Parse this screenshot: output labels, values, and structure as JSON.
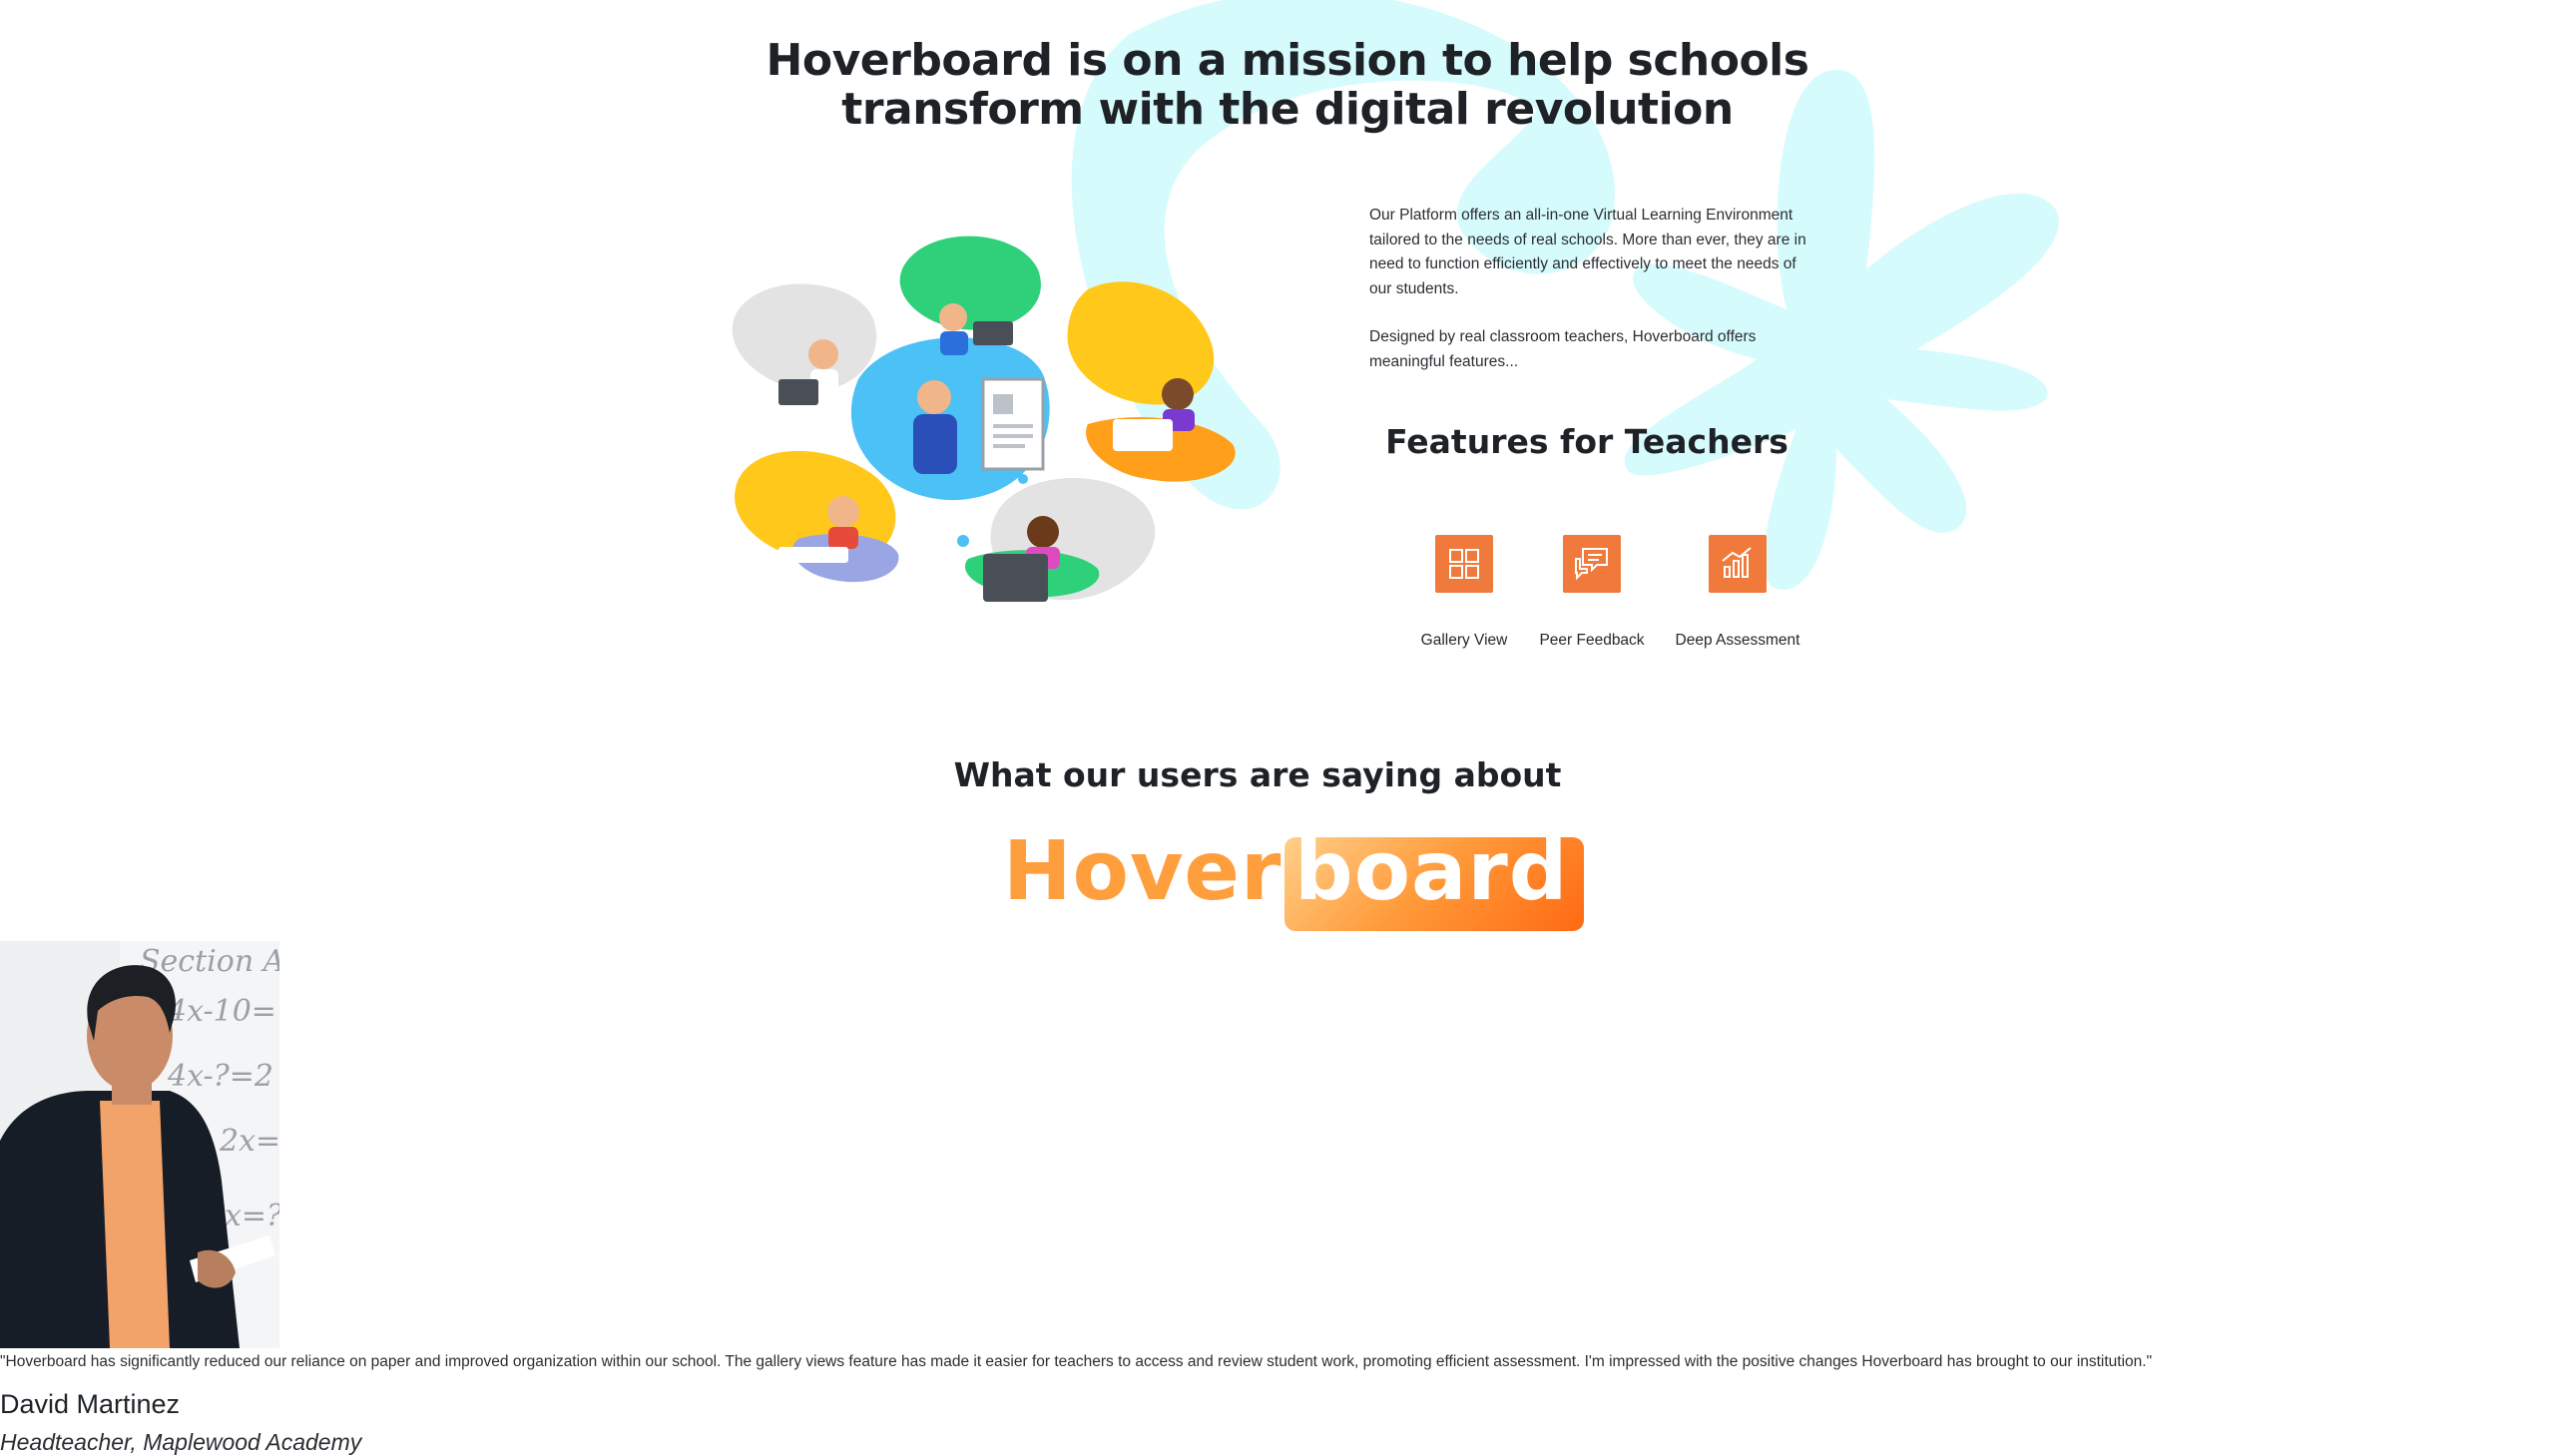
{
  "mission": {
    "title_line1": "Hoverboard is on a mission to help schools",
    "title_line2": "transform with the digital revolution"
  },
  "intro": {
    "paragraph1": "Our Platform offers an all-in-one Virtual Learning Environment tailored to the needs of real schools. More than ever, they are in need to function efficiently and effectively to meet the needs of our students.",
    "paragraph2": "Designed by real classroom teachers, Hoverboard offers meaningful features..."
  },
  "features": {
    "heading": "Features for Teachers",
    "items": [
      {
        "label": "Gallery View",
        "icon": "gallery-grid-icon"
      },
      {
        "label": "Peer Feedback",
        "icon": "chat-bubbles-icon"
      },
      {
        "label": "Deep Assessment",
        "icon": "bar-chart-icon"
      }
    ]
  },
  "testimonials": {
    "heading": "What our users are saying about",
    "logo_part1": "Hover",
    "logo_part2": "board",
    "quote": "\"Hoverboard has significantly reduced our reliance on paper and improved organization within our school. The gallery views feature has made it easier for teachers to access and review student work, promoting efficient assessment. I'm impressed with the positive changes Hoverboard has brought to our institution.\"",
    "name": "David Martinez",
    "role": "Headteacher, Maplewood Academy",
    "photo_board_text": [
      "Section A",
      "4x-10=",
      "4x-?=2",
      "2x=",
      "x=?"
    ]
  },
  "colors": {
    "accent": "#f07a3c",
    "logo_orange": "#ff9e3d",
    "decor_cyan": "#ccfbfc",
    "heading": "#1e2227"
  }
}
